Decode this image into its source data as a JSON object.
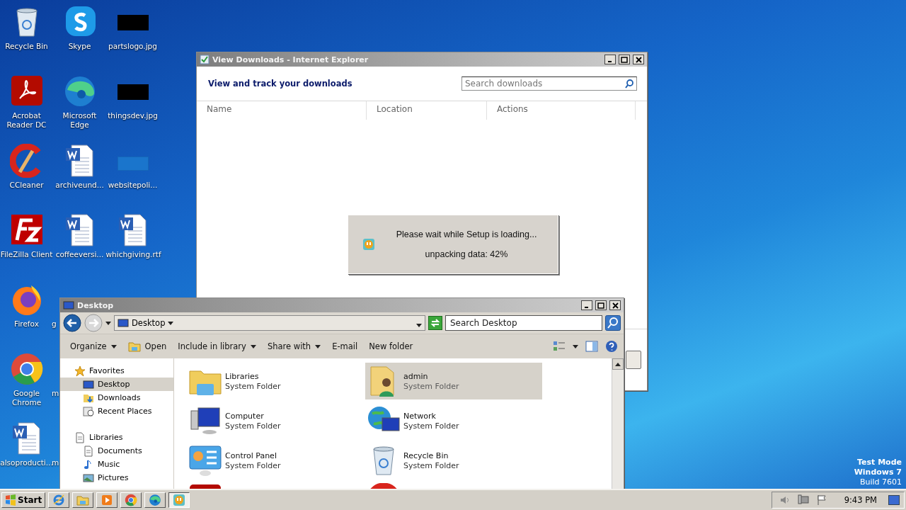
{
  "desktop": {
    "columns": [
      [
        {
          "label": "Recycle Bin",
          "kind": "recycle-bin"
        },
        {
          "label": "Acrobat Reader DC",
          "kind": "acrobat"
        },
        {
          "label": "CCleaner",
          "kind": "ccleaner"
        },
        {
          "label": "FileZilla Client",
          "kind": "filezilla"
        },
        {
          "label": "Firefox",
          "kind": "firefox"
        },
        {
          "label": "Google Chrome",
          "kind": "chrome"
        },
        {
          "label": "alsoproducti...",
          "kind": "word"
        }
      ],
      [
        {
          "label": "Skype",
          "kind": "skype"
        },
        {
          "label": "Microsoft Edge",
          "kind": "edge"
        },
        {
          "label": "archiveund...",
          "kind": "word"
        },
        {
          "label": "coffeeversi...",
          "kind": "word"
        },
        {
          "label": "g",
          "kind": "covered"
        },
        {
          "label": "m",
          "kind": "covered"
        },
        {
          "label": "m",
          "kind": "covered"
        }
      ],
      [
        {
          "label": "partslogo.jpg",
          "kind": "image-dark"
        },
        {
          "label": "thingsdev.jpg",
          "kind": "image-dark"
        },
        {
          "label": "websitepoli...",
          "kind": "image-blue"
        },
        {
          "label": "whichgiving.rtf",
          "kind": "word"
        }
      ]
    ],
    "edition": [
      "Test Mode",
      "Windows 7",
      "Build 7601"
    ]
  },
  "downloads_window": {
    "title": "View Downloads - Internet Explorer",
    "heading": "View and track your downloads",
    "search": {
      "placeholder": "Search downloads"
    },
    "columns": [
      "Name",
      "Location",
      "Actions"
    ]
  },
  "setup_dialog": {
    "message": "Please wait while Setup is loading...",
    "status": "unpacking data: 42%"
  },
  "explorer_window": {
    "title": "Desktop",
    "address": "Desktop",
    "search": {
      "placeholder": "Search Desktop"
    },
    "toolbar": [
      {
        "label": "Organize",
        "kind": "menu"
      },
      {
        "label": "Open",
        "kind": "open"
      },
      {
        "label": "Include in library",
        "kind": "menu"
      },
      {
        "label": "Share with",
        "kind": "menu"
      },
      {
        "label": "E-mail",
        "kind": "plain"
      },
      {
        "label": "New folder",
        "kind": "plain"
      }
    ],
    "navigation": [
      {
        "label": "Favorites",
        "kind": "star",
        "children": [
          {
            "label": "Desktop",
            "kind": "desktop",
            "selected": true
          },
          {
            "label": "Downloads",
            "kind": "downloads",
            "selected": false
          },
          {
            "label": "Recent Places",
            "kind": "recent",
            "selected": false
          }
        ]
      },
      {
        "label": "Libraries",
        "kind": "library",
        "children": [
          {
            "label": "Documents",
            "kind": "document",
            "selected": false
          },
          {
            "label": "Music",
            "kind": "music",
            "selected": false
          },
          {
            "label": "Pictures",
            "kind": "pictures",
            "selected": false
          }
        ]
      }
    ],
    "items": [
      {
        "name": "Libraries",
        "type": "System Folder",
        "kind": "library",
        "selected": false
      },
      {
        "name": "admin",
        "type": "System Folder",
        "kind": "user",
        "selected": true
      },
      {
        "name": "Computer",
        "type": "System Folder",
        "kind": "computer",
        "selected": false
      },
      {
        "name": "Network",
        "type": "System Folder",
        "kind": "network",
        "selected": false
      },
      {
        "name": "Control Panel",
        "type": "System Folder",
        "kind": "control-panel",
        "selected": false
      },
      {
        "name": "Recycle Bin",
        "type": "System Folder",
        "kind": "recycle-bin",
        "selected": false
      },
      {
        "kind": "acrobat",
        "selected": false
      },
      {
        "kind": "ccleaner",
        "selected": false
      }
    ]
  },
  "taskbar": {
    "start": "Start",
    "buttons": [
      {
        "kind": "ie",
        "selected": false
      },
      {
        "kind": "explorer",
        "selected": false
      },
      {
        "kind": "media",
        "selected": false
      },
      {
        "kind": "chrome",
        "selected": false
      },
      {
        "kind": "edge",
        "selected": false
      },
      {
        "kind": "setup",
        "selected": true
      }
    ],
    "clock": "9:43 PM"
  }
}
